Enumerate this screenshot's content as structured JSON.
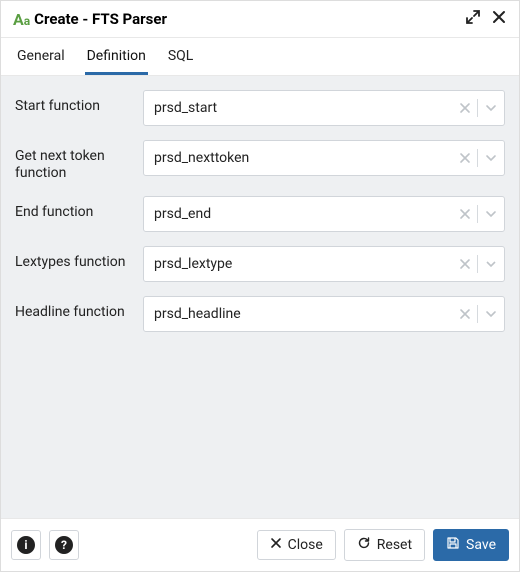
{
  "header": {
    "title": "Create - FTS Parser"
  },
  "tabs": [
    {
      "label": "General"
    },
    {
      "label": "Definition"
    },
    {
      "label": "SQL"
    }
  ],
  "active_tab_index": 1,
  "fields": {
    "start": {
      "label": "Start function",
      "value": "prsd_start"
    },
    "next_token": {
      "label": "Get next token function",
      "value": "prsd_nexttoken"
    },
    "end": {
      "label": "End function",
      "value": "prsd_end"
    },
    "lextypes": {
      "label": "Lextypes function",
      "value": "prsd_lextype"
    },
    "headline": {
      "label": "Headline function",
      "value": "prsd_headline"
    }
  },
  "footer": {
    "close": "Close",
    "reset": "Reset",
    "save": "Save"
  }
}
